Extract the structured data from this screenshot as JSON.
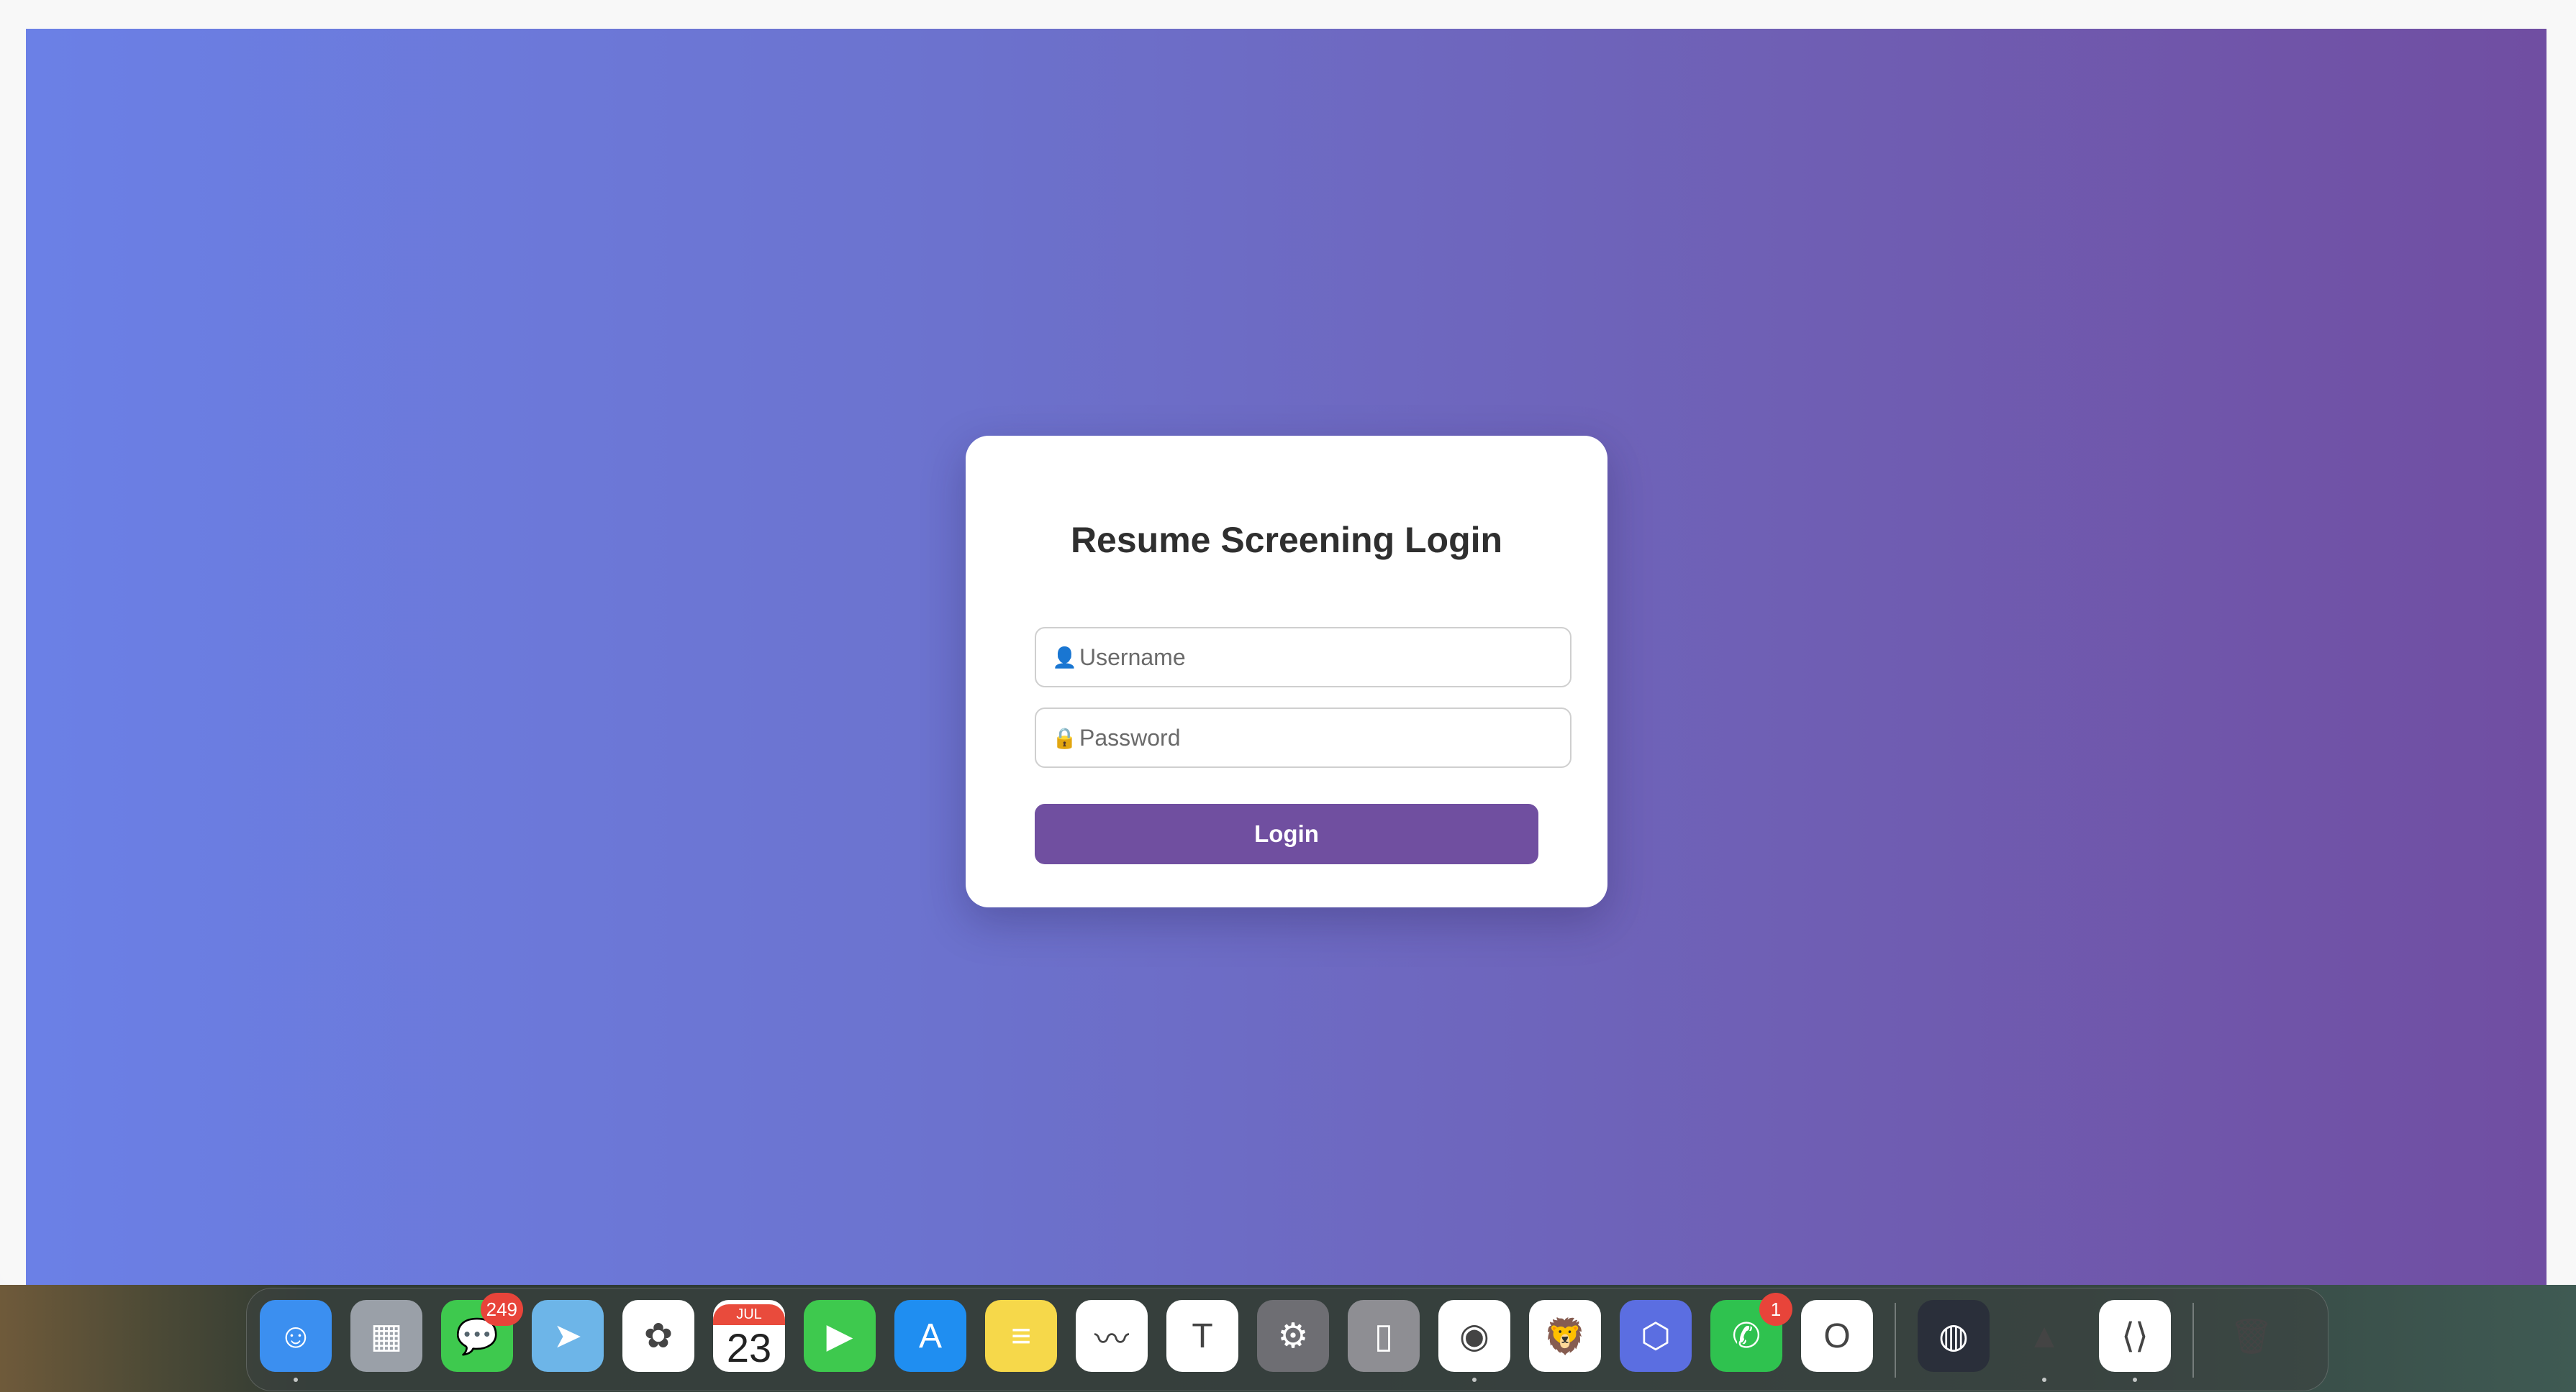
{
  "login": {
    "title": "Resume Screening Login",
    "username_placeholder": "Username",
    "password_placeholder": "Password",
    "username_icon": "👤",
    "password_icon": "🔒",
    "button_label": "Login"
  },
  "colors": {
    "gradient_start": "#6b80e6",
    "gradient_end": "#704ea2",
    "button": "#704fa0"
  },
  "dock": {
    "items": [
      {
        "name": "finder-icon",
        "glyph": "☺",
        "bg": "#3b8ff0",
        "running": true
      },
      {
        "name": "launchpad-icon",
        "glyph": "▦",
        "bg": "#9aa0a8"
      },
      {
        "name": "messages-icon",
        "glyph": "💬",
        "bg": "#3ec94e",
        "badge": "249"
      },
      {
        "name": "maps-icon",
        "glyph": "➤",
        "bg": "#6db5e8"
      },
      {
        "name": "photos-icon",
        "glyph": "✿",
        "bg": "#ffffff"
      },
      {
        "name": "calendar-icon",
        "glyph": "",
        "bg": "#ffffff",
        "month": "JUL",
        "day": "23"
      },
      {
        "name": "facetime-icon",
        "glyph": "▶",
        "bg": "#3ec94e"
      },
      {
        "name": "app-store-icon",
        "glyph": "A",
        "bg": "#1f8ef1"
      },
      {
        "name": "notes-icon",
        "glyph": "≡",
        "bg": "#f6d84a"
      },
      {
        "name": "freeform-icon",
        "glyph": "〰",
        "bg": "#ffffff"
      },
      {
        "name": "teams-icon",
        "glyph": "T",
        "bg": "#ffffff"
      },
      {
        "name": "system-settings-icon",
        "glyph": "⚙",
        "bg": "#6e6e73"
      },
      {
        "name": "iphone-mirroring-icon",
        "glyph": "▯",
        "bg": "#8e8e93"
      },
      {
        "name": "chrome-icon",
        "glyph": "◉",
        "bg": "#ffffff",
        "running": true
      },
      {
        "name": "brave-icon",
        "glyph": "🦁",
        "bg": "#ffffff"
      },
      {
        "name": "copilot-icon",
        "glyph": "⬡",
        "bg": "#5b6ee1"
      },
      {
        "name": "whatsapp-icon",
        "glyph": "✆",
        "bg": "#2fc24f",
        "badge": "1"
      },
      {
        "name": "outlook-icon",
        "glyph": "O",
        "bg": "#ffffff"
      },
      {
        "name": "davinci-resolve-icon",
        "glyph": "◍",
        "bg": "#2a2f3a"
      },
      {
        "name": "vlc-icon",
        "glyph": "▲",
        "bg": "transparent",
        "running": true
      },
      {
        "name": "vscode-icon",
        "glyph": "⟨⟩",
        "bg": "#ffffff",
        "running": true
      },
      {
        "name": "trash-icon",
        "glyph": "🗑",
        "bg": "transparent"
      }
    ]
  }
}
